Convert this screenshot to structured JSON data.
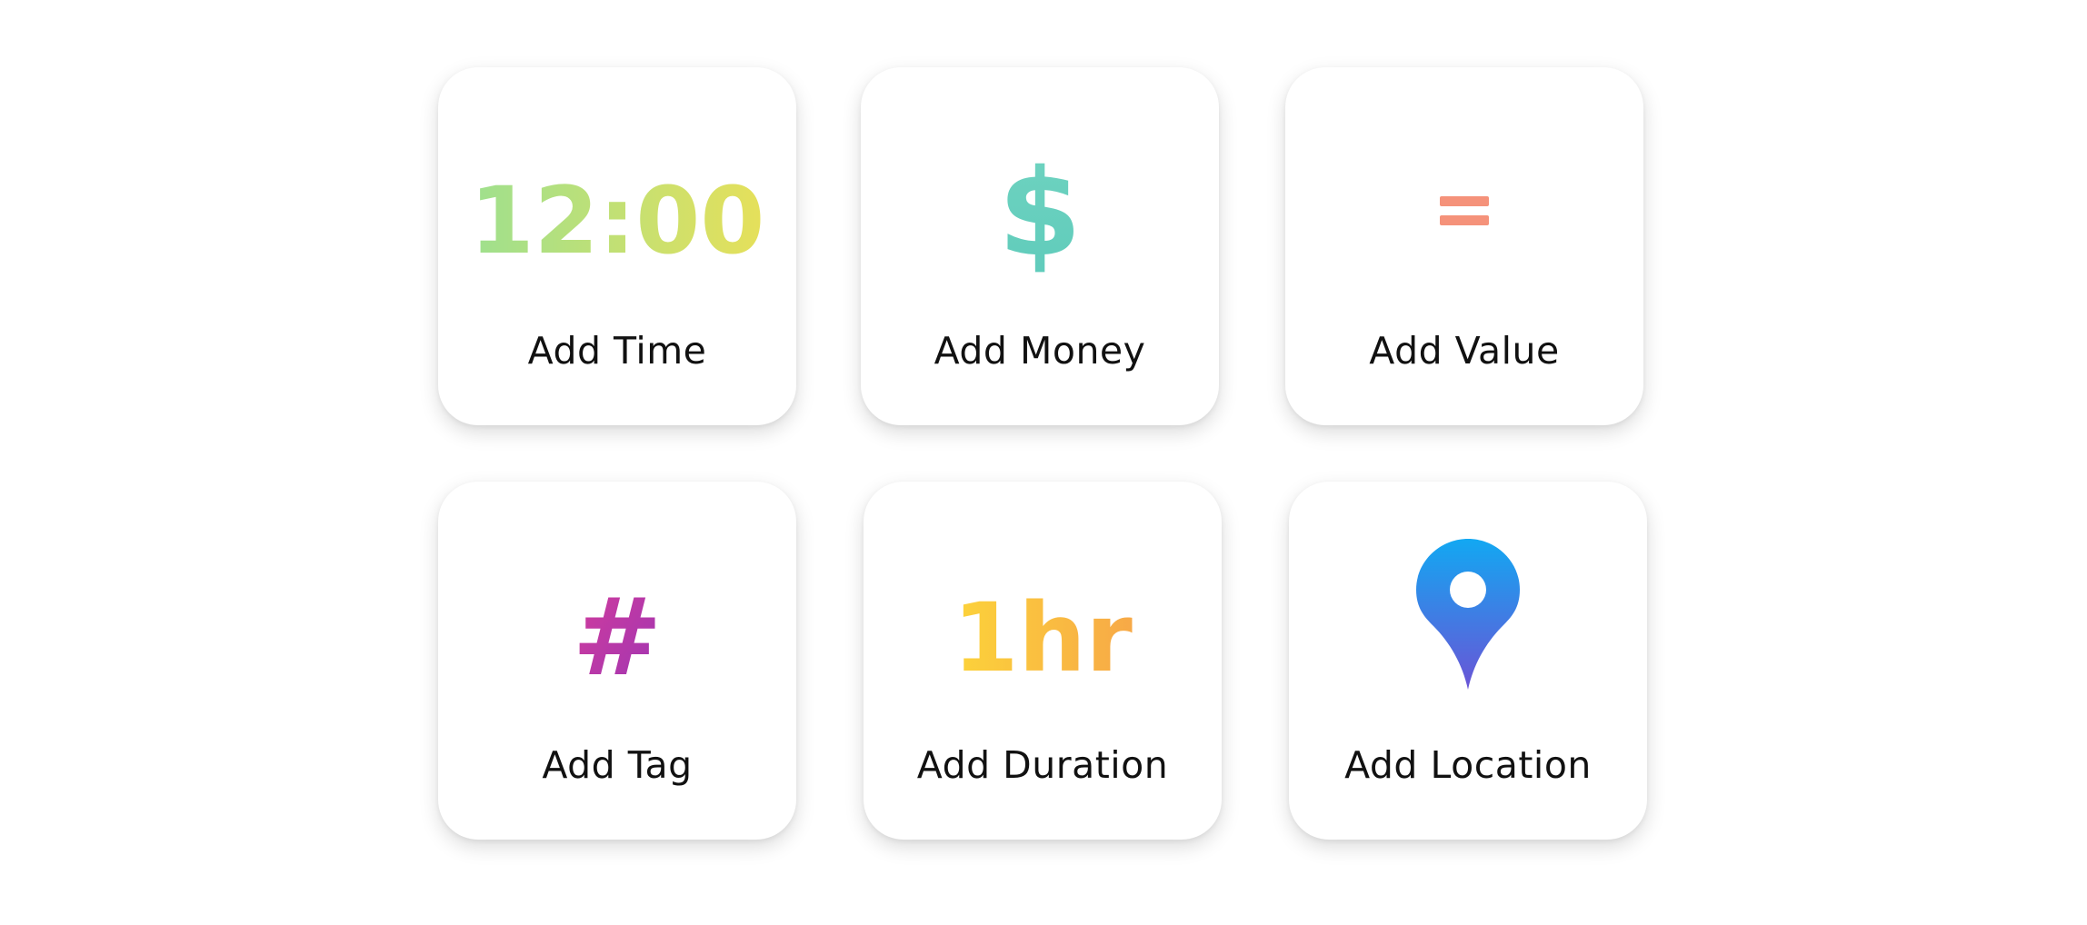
{
  "tiles": [
    {
      "label": "Add Time",
      "icon": "clock-text-icon",
      "glyph": "12:00",
      "colors": [
        "#9ee08e",
        "#e6e05a"
      ]
    },
    {
      "label": "Add Money",
      "icon": "dollar-icon",
      "glyph": "$",
      "colors": [
        "#6fd3c0",
        "#5fcbbb"
      ]
    },
    {
      "label": "Add Value",
      "icon": "equals-icon",
      "glyph": "=",
      "colors": [
        "#f5927a",
        "#f5927a"
      ]
    },
    {
      "label": "Add Tag",
      "icon": "hashtag-icon",
      "glyph": "#",
      "colors": [
        "#d63c9a",
        "#9b35b5"
      ]
    },
    {
      "label": "Add Duration",
      "icon": "duration-text-icon",
      "glyph": "1hr",
      "colors": [
        "#fcd33a",
        "#f7a947"
      ]
    },
    {
      "label": "Add Location",
      "icon": "map-pin-icon",
      "glyph": "",
      "colors": [
        "#12a8f2",
        "#6a54d6"
      ]
    }
  ]
}
